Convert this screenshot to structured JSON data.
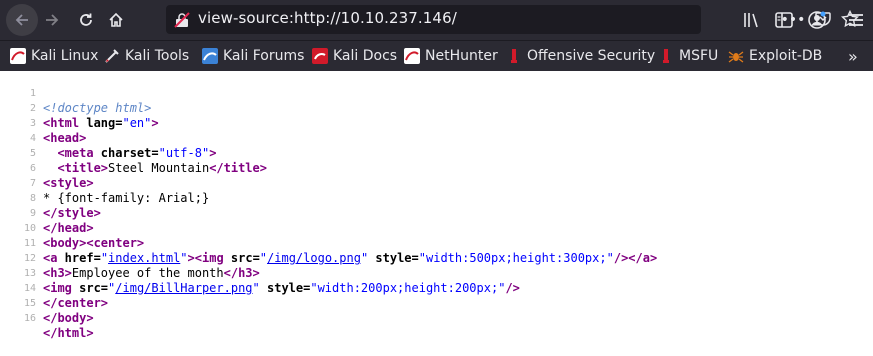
{
  "toolbar": {
    "url": "view-source:http://10.10.237.146/",
    "page_actions_label": "•••"
  },
  "bookmarks": [
    {
      "label": "Kali Linux",
      "icon": "kali-icon"
    },
    {
      "label": "Kali Tools",
      "icon": "kali-tools-icon"
    },
    {
      "label": "Kali Forums",
      "icon": "kali-forums-icon"
    },
    {
      "label": "Kali Docs",
      "icon": "kali-docs-icon"
    },
    {
      "label": "NetHunter",
      "icon": "nethunter-icon"
    },
    {
      "label": "Offensive Security",
      "icon": "offsec-icon"
    },
    {
      "label": "MSFU",
      "icon": "msfu-icon"
    },
    {
      "label": "Exploit-DB",
      "icon": "exploitdb-icon"
    }
  ],
  "overflow_label": "»",
  "source": {
    "line_numbers": [
      "1",
      "2",
      "3",
      "4",
      "5",
      "6",
      "7",
      "8",
      "9",
      "10",
      "11",
      "12",
      "13",
      "14",
      "15",
      "16"
    ],
    "doctype": "<!doctype html>",
    "l2_open": "<html",
    "l2_attr": " lang=",
    "l2_val": "\"en\"",
    "l2_close": ">",
    "l3": "<head>",
    "l4_open": "<meta",
    "l4_attr": " charset=",
    "l4_val": "\"utf-8\"",
    "l4_close": ">",
    "l5_open": "<title>",
    "l5_text": "Steel Mountain",
    "l5_close": "</title>",
    "l6": "<style>",
    "l7": "* {font-family: Arial;}",
    "l8": "</style>",
    "l9": "</head>",
    "l10": "<body><center>",
    "l11_a_open": "<a",
    "l11_href_attr": " href=",
    "l11_href_q1": "\"",
    "l11_href_link": "index.html",
    "l11_href_q2": "\"",
    "l11_gt": ">",
    "l11_img_open": "<img",
    "l11_src_attr": " src=",
    "l11_src_q1": "\"",
    "l11_src_link": "/img/logo.png",
    "l11_src_q2": "\"",
    "l11_style_attr": " style=",
    "l11_style_val": "\"width:500px;height:300px;\"",
    "l11_close": "/></a>",
    "l12_open": "<h3>",
    "l12_text": "Employee of the month",
    "l12_close": "</h3>",
    "l13_open": "<img",
    "l13_src_attr": " src=",
    "l13_src_q1": "\"",
    "l13_src_link": "/img/BillHarper.png",
    "l13_src_q2": "\"",
    "l13_style_attr": " style=",
    "l13_style_val": "\"width:200px;height:200px;\"",
    "l13_close": "/>",
    "l14": "</center>",
    "l15": "</body>",
    "l16": "</html>"
  },
  "colors": {
    "chrome_bg": "#2b2a33",
    "urlbar_bg": "#1c1b22",
    "tag": "#800080",
    "value": "#0000ff",
    "comment": "#5e86c6",
    "link": "#0000ee"
  }
}
